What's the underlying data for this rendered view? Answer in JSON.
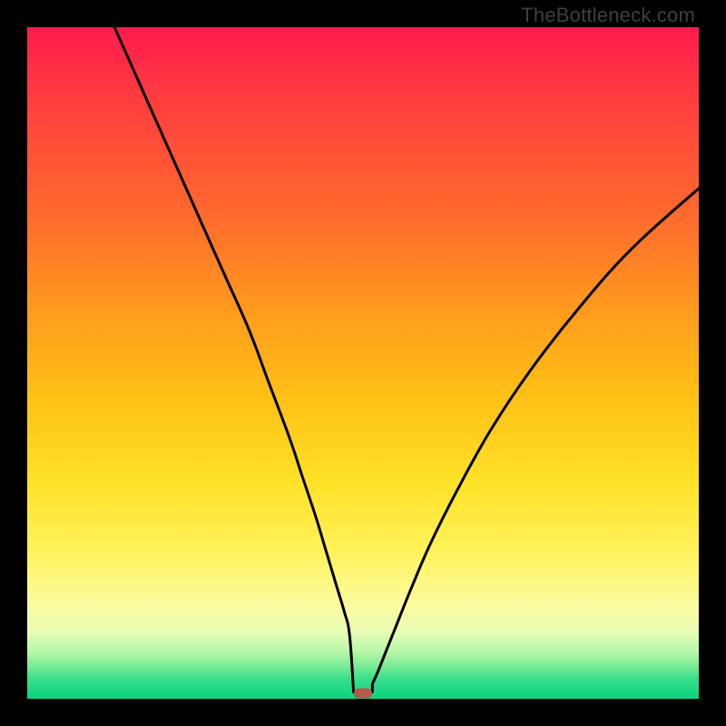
{
  "watermark": "TheBottleneck.com",
  "colors": {
    "curve": "#000000",
    "marker": "#b35a4a",
    "frame": "#000000"
  },
  "chart_data": {
    "type": "line",
    "title": "",
    "xlabel": "",
    "ylabel": "",
    "xlim": [
      0,
      100
    ],
    "ylim": [
      0,
      100
    ],
    "grid": false,
    "legend": false,
    "series": [
      {
        "name": "bottleneck-curve",
        "x": [
          13,
          17,
          21,
          25,
          29,
          33,
          36,
          39,
          41,
          43,
          44.5,
          46,
          47.2,
          48,
          48.7,
          49.2,
          49.6,
          50,
          50.4,
          50.8,
          51.4,
          52.2,
          53.4,
          55,
          57,
          60,
          64,
          69,
          75,
          82,
          90,
          100
        ],
        "values": [
          100,
          91,
          82,
          73,
          64,
          55,
          47,
          39,
          33,
          27,
          22,
          17,
          13,
          9.5,
          6.5,
          4,
          2.2,
          1,
          1,
          1.3,
          2.2,
          4,
          7,
          11,
          16,
          23,
          31,
          40,
          49,
          58,
          67,
          76
        ]
      }
    ],
    "marker": {
      "x": 50,
      "y": 0.8
    },
    "flat_bottom": {
      "x_start": 48.6,
      "x_end": 51.4,
      "y": 1
    }
  }
}
